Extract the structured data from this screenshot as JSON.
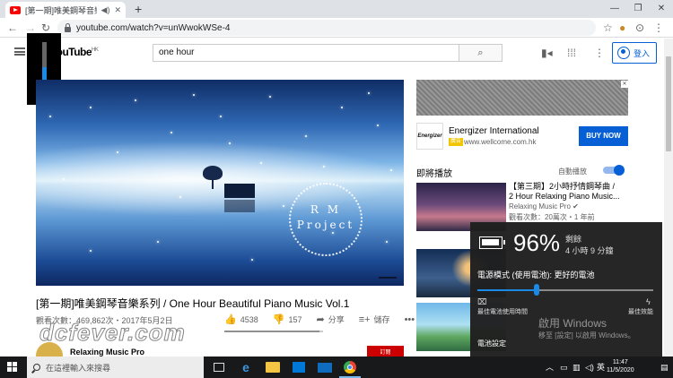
{
  "browser": {
    "tab_title": "[第一期]唯美鋼琴音樂系列 /",
    "url": "youtube.com/watch?v=unWwokWSe-4"
  },
  "youtube": {
    "logo": "YouTube",
    "logo_region": "HK",
    "search_query": "one hour",
    "signin_label": "登入"
  },
  "brightness": {
    "level_pct": 40
  },
  "video": {
    "overlay_line1": "R M",
    "overlay_line2": "Project",
    "title": "[第一期]唯美鋼琴音樂系列 / One Hour Beautiful Piano Music Vol.1",
    "views_date": "觀看次數：469,862次・2017年5月2日",
    "likes": "4538",
    "dislikes": "157",
    "share_label": "分享",
    "save_label": "儲存",
    "like_ratio": 0.967,
    "channel_name": "Relaxing Music Pro",
    "subscribe_label": "訂閱"
  },
  "ad": {
    "logo_text": "Energizer",
    "title": "Energizer International",
    "badge": "廣告",
    "url": "www.wellcome.com.hk",
    "button": "BUY NOW"
  },
  "sidebar": {
    "up_next_label": "即將播放",
    "autoplay_label": "自動播放",
    "rec1": {
      "title": "【第三期】2小時抒情鋼琴曲 / 2 Hour Relaxing Piano Music...",
      "channel": "Relaxing Music Pro",
      "meta": "觀看次數：20萬次・1 年前"
    }
  },
  "battery": {
    "percent": "96%",
    "level": 0.96,
    "remaining_label": "剩餘",
    "remaining_time": "4 小時 9 分鐘",
    "mode": "電源模式 (使用電池): 更好的電池",
    "slider_pct": 33,
    "left_label": "最佳電池使用時間",
    "right_label": "最佳效能",
    "settings_label": "電池設定"
  },
  "activation": {
    "line1": "啟用 Windows",
    "line2": "移至 [設定] 以啟用 Windows。"
  },
  "watermark": "dcfever.com",
  "taskbar": {
    "search_placeholder": "在這裡輸入來搜尋",
    "ime": "英",
    "time": "11:47",
    "date": "11/5/2020"
  }
}
